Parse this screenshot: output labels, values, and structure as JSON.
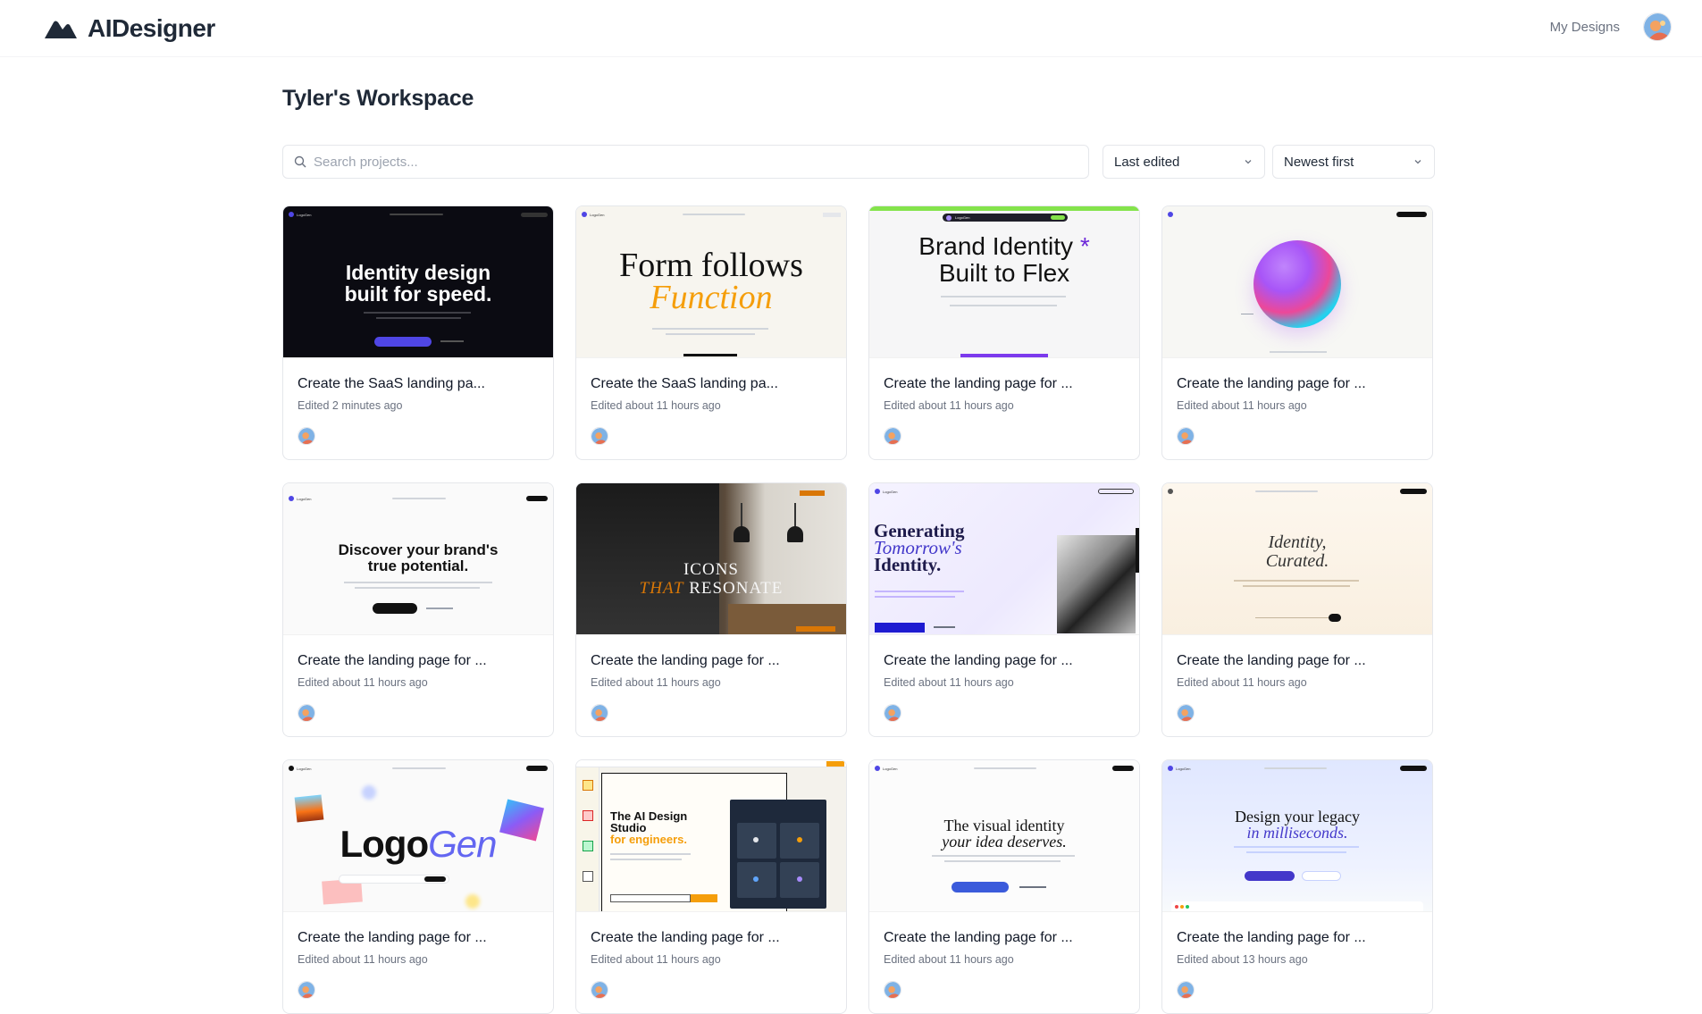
{
  "app": {
    "name": "AIDesigner"
  },
  "nav": {
    "my_designs": "My Designs"
  },
  "workspace": {
    "title": "Tyler's Workspace"
  },
  "search": {
    "placeholder": "Search projects..."
  },
  "sort": {
    "field": "Last edited",
    "order": "Newest first"
  },
  "cards": [
    {
      "title": "Create the SaaS landing pa...",
      "edited": "Edited 2 minutes ago",
      "thumb": {
        "headline_1": "Identity design",
        "headline_2": "built for speed.",
        "brand": "LogoGen"
      }
    },
    {
      "title": "Create the SaaS landing pa...",
      "edited": "Edited about 11 hours ago",
      "thumb": {
        "headline_1": "Form follows",
        "headline_2": "Function",
        "brand": "LogoGen"
      }
    },
    {
      "title": "Create the landing page for ...",
      "edited": "Edited about 11 hours ago",
      "thumb": {
        "headline_1": "Brand Identity",
        "headline_2": "Built to Flex",
        "brand": "LogoGen"
      }
    },
    {
      "title": "Create the landing page for ...",
      "edited": "Edited about 11 hours ago",
      "thumb": {}
    },
    {
      "title": "Create the landing page for ...",
      "edited": "Edited about 11 hours ago",
      "thumb": {
        "headline_1": "Discover your brand's",
        "headline_2": "true potential.",
        "brand": "LogoGen"
      }
    },
    {
      "title": "Create the landing page for ...",
      "edited": "Edited about 11 hours ago",
      "thumb": {
        "headline_1": "ICONS",
        "headline_2a": "THAT",
        "headline_2b": "RESONATE"
      }
    },
    {
      "title": "Create the landing page for ...",
      "edited": "Edited about 11 hours ago",
      "thumb": {
        "headline_1": "Generating",
        "headline_2": "Tomorrow's",
        "headline_3": "Identity.",
        "brand": "LogoGen"
      }
    },
    {
      "title": "Create the landing page for ...",
      "edited": "Edited about 11 hours ago",
      "thumb": {
        "headline_1": "Identity,",
        "headline_2": "Curated."
      }
    },
    {
      "title": "Create the landing page for ...",
      "edited": "Edited about 11 hours ago",
      "thumb": {
        "headline_1": "Logo",
        "headline_2": "Gen",
        "brand": "LogoGen"
      }
    },
    {
      "title": "Create the landing page for ...",
      "edited": "Edited about 11 hours ago",
      "thumb": {
        "headline_1": "The AI Design",
        "headline_2": "Studio",
        "headline_3": "for engineers."
      }
    },
    {
      "title": "Create the landing page for ...",
      "edited": "Edited about 11 hours ago",
      "thumb": {
        "headline_1": "The visual identity",
        "headline_2": "your idea deserves.",
        "brand": "LogoGen"
      }
    },
    {
      "title": "Create the landing page for ...",
      "edited": "Edited about 13 hours ago",
      "thumb": {
        "headline_1": "Design your legacy",
        "headline_2": "in milliseconds.",
        "brand": "LogoGen"
      }
    }
  ],
  "colors": {
    "accent": "#4f46e5",
    "orange": "#f59e0b",
    "border": "#e5e7eb"
  },
  "icons": {
    "logo": "aidesigner-logo-icon",
    "search": "search-icon",
    "chevron": "chevron-down-icon",
    "avatar": "user-avatar"
  }
}
